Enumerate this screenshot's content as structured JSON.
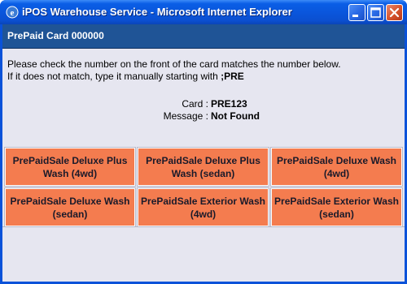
{
  "window": {
    "title": "iPOS Warehouse Service - Microsoft Internet Explorer",
    "controls": {
      "minimize_icon": "minimize-icon",
      "maximize_icon": "maximize-icon",
      "close_icon": "close-icon"
    }
  },
  "header": {
    "title": "PrePaid Card 000000"
  },
  "instructions": {
    "line1": "Please check the number on the front of the card matches the number below.",
    "line2_prefix": "If it does not match, type it manually starting with ",
    "line2_code": ";PRE"
  },
  "card": {
    "card_label": "Card :",
    "card_value": "PRE123",
    "message_label": "Message :",
    "message_value": "Not Found"
  },
  "products": [
    {
      "label": "PrePaidSale Deluxe Plus Wash (4wd)"
    },
    {
      "label": "PrePaidSale Deluxe Plus Wash (sedan)"
    },
    {
      "label": "PrePaidSale Deluxe Wash (4wd)"
    },
    {
      "label": "PrePaidSale Deluxe Wash (sedan)"
    },
    {
      "label": "PrePaidSale Exterior Wash (4wd)"
    },
    {
      "label": "PrePaidSale Exterior Wash (sedan)"
    }
  ],
  "colors": {
    "titlebar": "#0a55db",
    "header_bar": "#1f5496",
    "client_bg": "#e6e6f0",
    "tile_bg": "#f47c4f"
  }
}
